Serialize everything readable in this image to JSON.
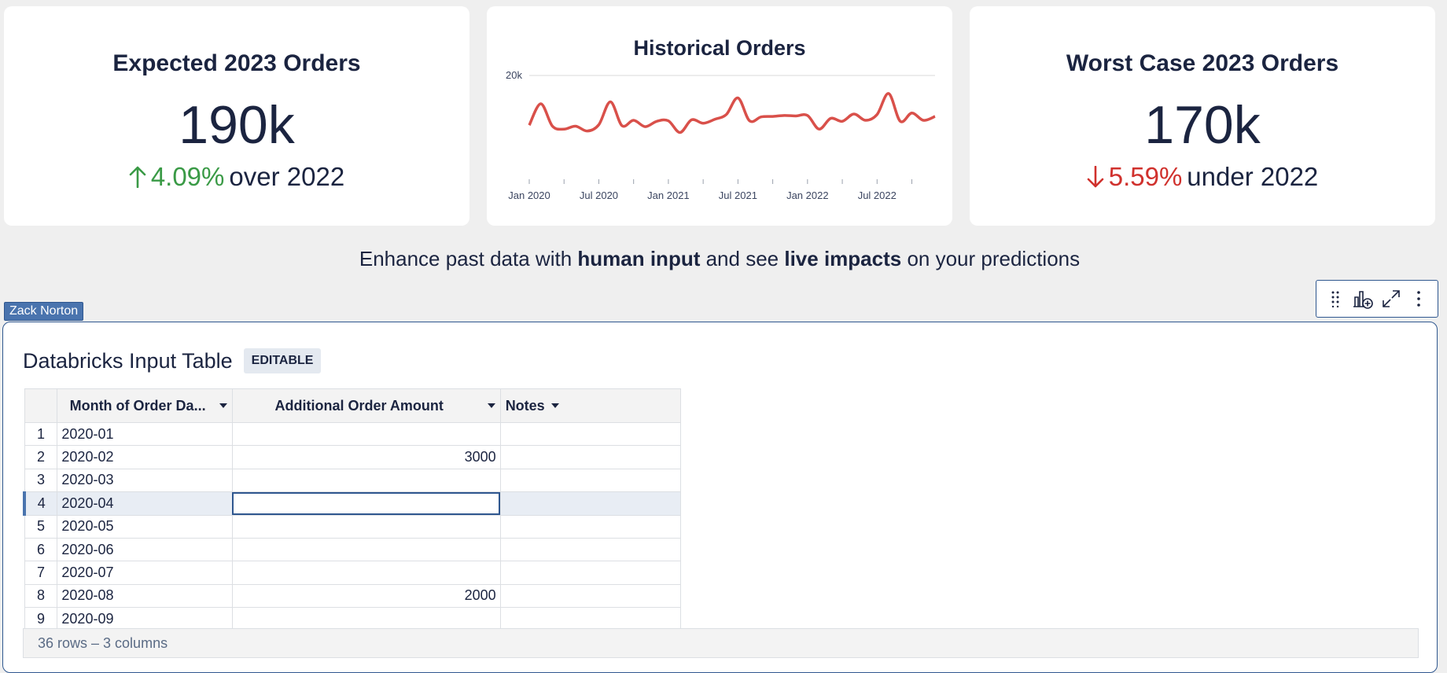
{
  "kpis": {
    "expected": {
      "title": "Expected 2023 Orders",
      "value": "190k",
      "delta": "4.09%",
      "suffix": "over 2022",
      "direction": "up",
      "color": "#3a9a46"
    },
    "worst": {
      "title": "Worst Case 2023 Orders",
      "value": "170k",
      "delta": "5.59%",
      "suffix": "under 2022",
      "direction": "down",
      "color": "#d0312d"
    }
  },
  "historical": {
    "title": "Historical Orders"
  },
  "chart_data": {
    "type": "line",
    "title": "Historical Orders",
    "xlabel": "",
    "ylabel": "",
    "y_tick_labels": [
      "20k"
    ],
    "ylim": [
      0,
      20000
    ],
    "grid": true,
    "x_tick_labels": [
      "Jan 2020",
      "Jul 2020",
      "Jan 2021",
      "Jul 2021",
      "Jan 2022",
      "Jul 2022"
    ],
    "color": "#d9504a",
    "x": [
      "2020-01",
      "2020-02",
      "2020-03",
      "2020-04",
      "2020-05",
      "2020-06",
      "2020-07",
      "2020-08",
      "2020-09",
      "2020-10",
      "2020-11",
      "2020-12",
      "2021-01",
      "2021-02",
      "2021-03",
      "2021-04",
      "2021-05",
      "2021-06",
      "2021-07",
      "2021-08",
      "2021-09",
      "2021-10",
      "2021-11",
      "2021-12",
      "2022-01",
      "2022-02",
      "2022-03",
      "2022-04",
      "2022-05",
      "2022-06",
      "2022-07",
      "2022-08",
      "2022-09",
      "2022-10",
      "2022-11",
      "2022-12"
    ],
    "values": [
      9800,
      14200,
      9600,
      9000,
      9600,
      8600,
      9900,
      14600,
      9700,
      10800,
      9500,
      10600,
      10700,
      8300,
      10900,
      10200,
      11000,
      12000,
      15400,
      10700,
      11500,
      11600,
      11800,
      11700,
      11800,
      9000,
      11200,
      10600,
      12100,
      10800,
      12000,
      16300,
      10600,
      12300,
      10800,
      11600
    ]
  },
  "tagline": {
    "part1": "Enhance past data with ",
    "bold1": "human input",
    "part2": " and see ",
    "bold2": "live impacts",
    "part3": " on your predictions"
  },
  "user_tag": "Zack Norton",
  "toolbar": {
    "icons": [
      "drag-handle-icon",
      "add-chart-icon",
      "expand-icon",
      "more-options-icon"
    ]
  },
  "table": {
    "title": "Databricks Input Table",
    "badge": "EDITABLE",
    "columns": [
      "Month of Order Da...",
      "Additional Order Amount",
      "Notes"
    ],
    "rows": [
      {
        "n": "1",
        "month": "2020-01",
        "amount": "",
        "notes": ""
      },
      {
        "n": "2",
        "month": "2020-02",
        "amount": "3000",
        "notes": ""
      },
      {
        "n": "3",
        "month": "2020-03",
        "amount": "",
        "notes": ""
      },
      {
        "n": "4",
        "month": "2020-04",
        "amount": "",
        "notes": ""
      },
      {
        "n": "5",
        "month": "2020-05",
        "amount": "",
        "notes": ""
      },
      {
        "n": "6",
        "month": "2020-06",
        "amount": "",
        "notes": ""
      },
      {
        "n": "7",
        "month": "2020-07",
        "amount": "",
        "notes": ""
      },
      {
        "n": "8",
        "month": "2020-08",
        "amount": "2000",
        "notes": ""
      },
      {
        "n": "9",
        "month": "2020-09",
        "amount": "",
        "notes": ""
      }
    ],
    "selected_row": 3,
    "footer": "36 rows – 3 columns"
  }
}
